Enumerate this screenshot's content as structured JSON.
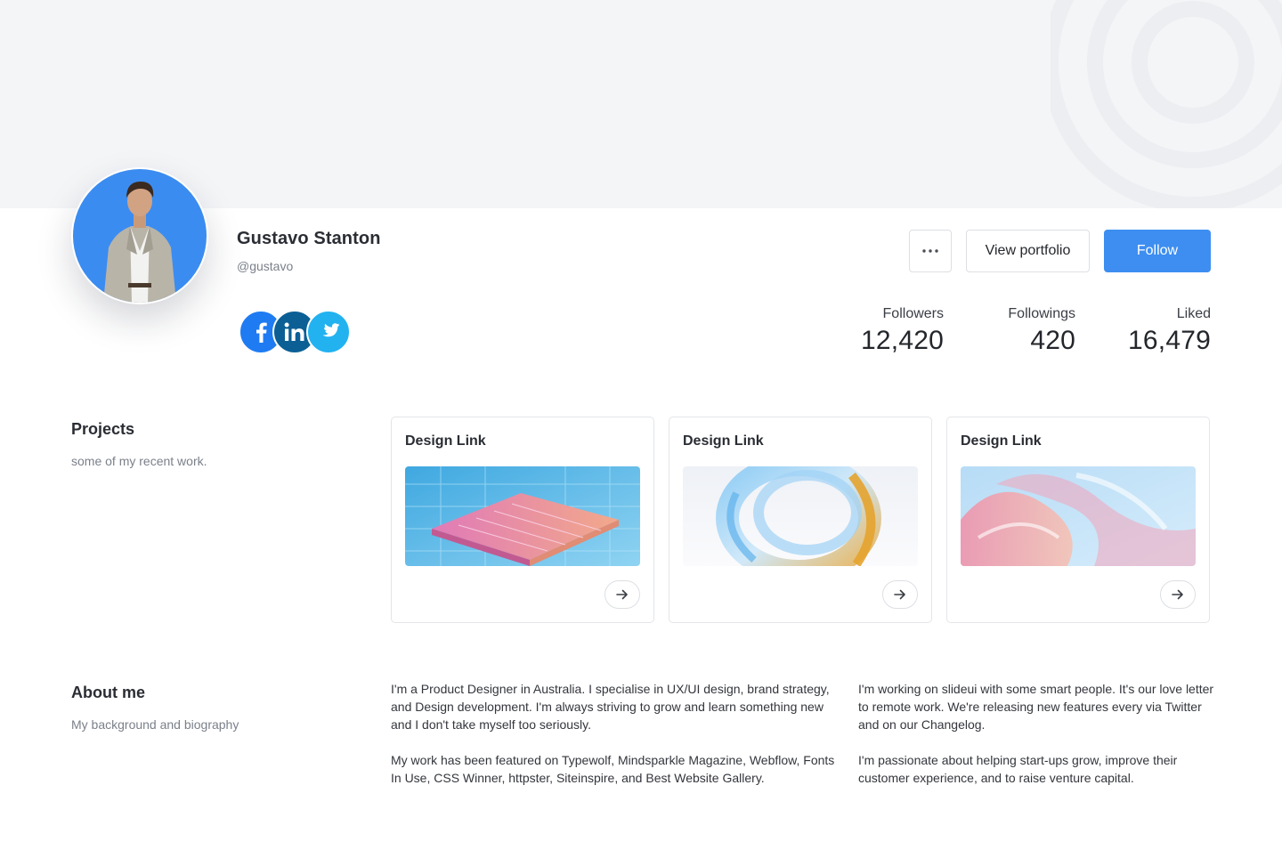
{
  "profile": {
    "name": "Gustavo Stanton",
    "handle": "@gustavo"
  },
  "social": [
    {
      "icon": "facebook-icon",
      "color": "#1f7bf2"
    },
    {
      "icon": "linkedin-icon",
      "color": "#0b5f95"
    },
    {
      "icon": "twitter-icon",
      "color": "#22b2f0"
    }
  ],
  "actions": {
    "more_icon": "ellipsis-icon",
    "portfolio_label": "View portfolio",
    "follow_label": "Follow"
  },
  "stats": {
    "followers": {
      "label": "Followers",
      "value": "12,420"
    },
    "followings": {
      "label": "Followings",
      "value": "420"
    },
    "liked": {
      "label": "Liked",
      "value": "16,479"
    }
  },
  "projects": {
    "title": "Projects",
    "subtitle": "some of my recent work.",
    "cards": [
      {
        "title": "Design Link",
        "image": "circuit-chip-image",
        "arrow_icon": "arrow-right-icon"
      },
      {
        "title": "Design Link",
        "image": "glass-ring-image",
        "arrow_icon": "arrow-right-icon"
      },
      {
        "title": "Design Link",
        "image": "glass-waves-image",
        "arrow_icon": "arrow-right-icon"
      }
    ]
  },
  "about": {
    "title": "About me",
    "subtitle": "My background and biography",
    "col1": [
      "I'm a Product Designer in Australia. I specialise in UX/UI design, brand strategy, and Design development. I'm always striving to grow and learn something new and I don't take myself too seriously.",
      "My work has been featured on Typewolf, Mindsparkle Magazine, Webflow, Fonts In Use, CSS Winner, httpster, Siteinspire, and Best Website Gallery."
    ],
    "col2": [
      "I'm working on slideui with some smart people. It's our love letter to remote work. We're releasing new features every via Twitter and on our Changelog.",
      "I'm passionate about helping start-ups grow, improve their customer experience, and to raise venture capital."
    ]
  },
  "colors": {
    "accent": "#3d8ef0",
    "cover": "#f4f5f7",
    "avatar_bg": "#3b8cf0"
  }
}
